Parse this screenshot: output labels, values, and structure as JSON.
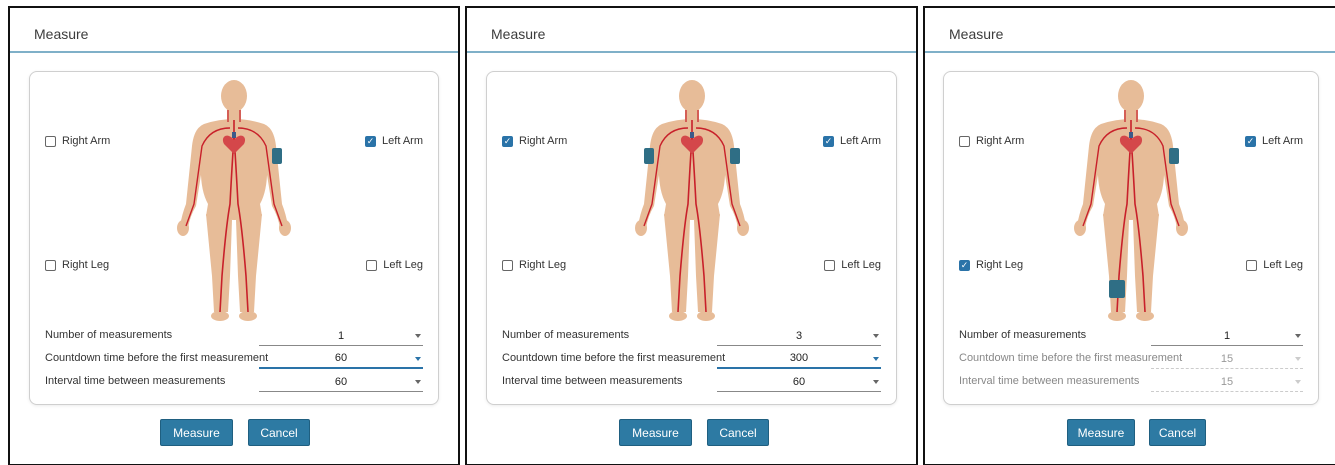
{
  "dialogs": [
    {
      "title": "Measure",
      "checkboxes": {
        "right_arm": {
          "label": "Right Arm",
          "checked": false
        },
        "left_arm": {
          "label": "Left Arm",
          "checked": true
        },
        "right_leg": {
          "label": "Right Leg",
          "checked": false
        },
        "left_leg": {
          "label": "Left Leg",
          "checked": false
        }
      },
      "fields": [
        {
          "label": "Number of measurements",
          "value": "1"
        },
        {
          "label": "Countdown time before the  first measurement",
          "value": "60"
        },
        {
          "label": "Interval time between measurements",
          "value": "60"
        }
      ],
      "buttons": {
        "measure": "Measure",
        "cancel": "Cancel"
      }
    },
    {
      "title": "Measure",
      "checkboxes": {
        "right_arm": {
          "label": "Right Arm",
          "checked": true
        },
        "left_arm": {
          "label": "Left Arm",
          "checked": true
        },
        "right_leg": {
          "label": "Right Leg",
          "checked": false
        },
        "left_leg": {
          "label": "Left Leg",
          "checked": false
        }
      },
      "fields": [
        {
          "label": "Number of measurements",
          "value": "3"
        },
        {
          "label": "Countdown time before the  first measurement",
          "value": "300"
        },
        {
          "label": "Interval time between measurements",
          "value": "60"
        }
      ],
      "buttons": {
        "measure": "Measure",
        "cancel": "Cancel"
      }
    },
    {
      "title": "Measure",
      "checkboxes": {
        "right_arm": {
          "label": "Right Arm",
          "checked": false
        },
        "left_arm": {
          "label": "Left Arm",
          "checked": true
        },
        "right_leg": {
          "label": "Right Leg",
          "checked": true
        },
        "left_leg": {
          "label": "Left Leg",
          "checked": false
        }
      },
      "fields": [
        {
          "label": "Number of measurements",
          "value": "1"
        },
        {
          "label": "Countdown time before the  first measurement",
          "value": "15"
        },
        {
          "label": "Interval time between measurements",
          "value": "15"
        }
      ],
      "buttons": {
        "measure": "Measure",
        "cancel": "Cancel"
      }
    }
  ],
  "colors": {
    "accent": "#2d7aa3",
    "skin": "#e7bc98",
    "artery": "#c8202a",
    "cuff": "#2f6e85",
    "heart": "#d4474a"
  }
}
